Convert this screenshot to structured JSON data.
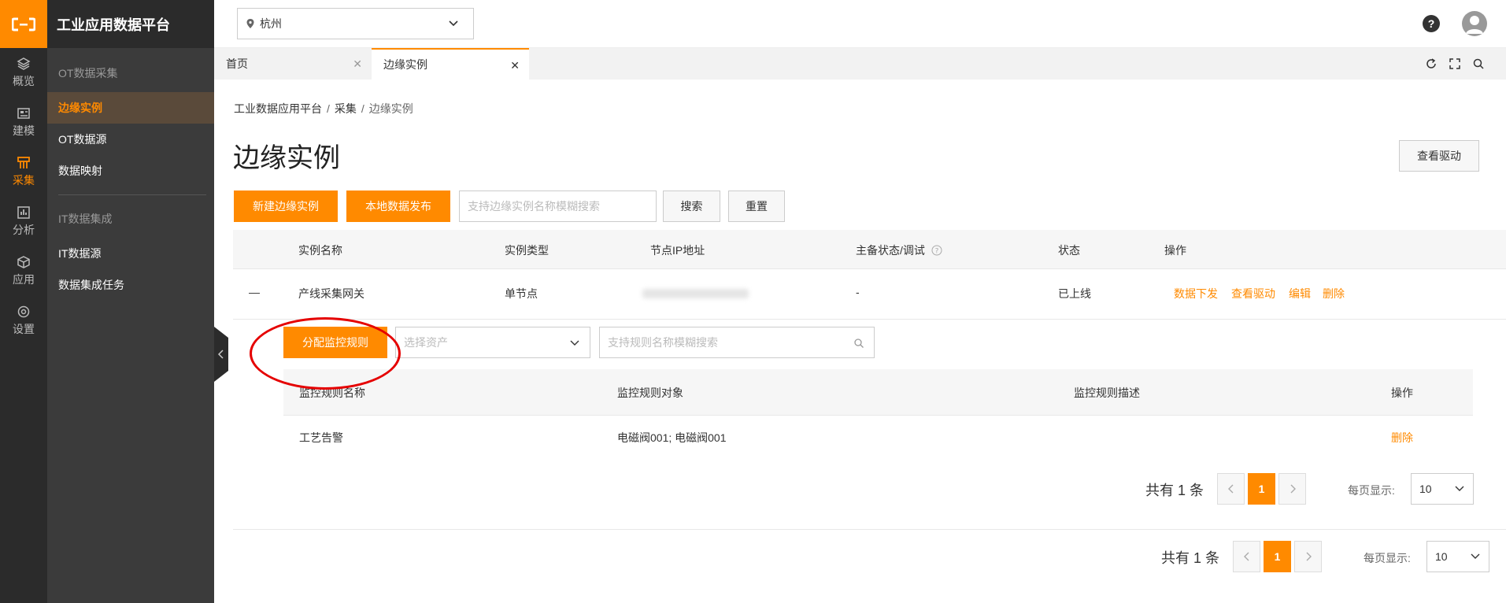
{
  "brand": {
    "title": "工业应用数据平台",
    "accent": "#ff8a00"
  },
  "rail": [
    {
      "label": "概览",
      "icon": "layers-icon"
    },
    {
      "label": "建模",
      "icon": "model-icon"
    },
    {
      "label": "采集",
      "icon": "collect-icon",
      "active": true
    },
    {
      "label": "分析",
      "icon": "chart-icon"
    },
    {
      "label": "应用",
      "icon": "cube-icon"
    },
    {
      "label": "设置",
      "icon": "settings-icon"
    }
  ],
  "sidebar": {
    "group1": "OT数据采集",
    "items1": [
      "边缘实例",
      "OT数据源",
      "数据映射"
    ],
    "group2": "IT数据集成",
    "items2": [
      "IT数据源",
      "数据集成任务"
    ]
  },
  "header": {
    "city": "杭州",
    "help": "?"
  },
  "tabs": [
    {
      "label": "首页"
    },
    {
      "label": "边缘实例",
      "active": true
    }
  ],
  "breadcrumb": {
    "l1": "工业数据应用平台",
    "sep": "/",
    "l2": "采集",
    "l3": "边缘实例"
  },
  "page": {
    "title": "边缘实例",
    "view_driver_btn": "查看驱动",
    "new_btn": "新建边缘实例",
    "publish_btn": "本地数据发布",
    "search_placeholder": "支持边缘实例名称模糊搜索",
    "search_btn": "搜索",
    "reset_btn": "重置"
  },
  "table": {
    "headers": [
      "实例名称",
      "实例类型",
      "节点IP地址",
      "主备状态/调试",
      "状态",
      "操作"
    ],
    "row": {
      "expand": "—",
      "name": "产线采集网关",
      "type": "单节点",
      "ha": "-",
      "status": "已上线",
      "actions": [
        "数据下发",
        "查看驱动",
        "编辑",
        "删除"
      ]
    }
  },
  "sub": {
    "assign_btn": "分配监控规则",
    "asset_placeholder": "选择资产",
    "rule_placeholder": "支持规则名称模糊搜索",
    "headers": [
      "监控规则名称",
      "监控规则对象",
      "监控规则描述",
      "操作"
    ],
    "row": {
      "name": "工艺告警",
      "target": "电磁阀001; 电磁阀001",
      "desc": "",
      "action": "删除"
    },
    "pager": {
      "total": "共有 1 条",
      "page": "1",
      "size_label": "每页显示:",
      "size": "10"
    }
  },
  "pager": {
    "total": "共有 1 条",
    "page": "1",
    "size_label": "每页显示:",
    "size": "10"
  }
}
